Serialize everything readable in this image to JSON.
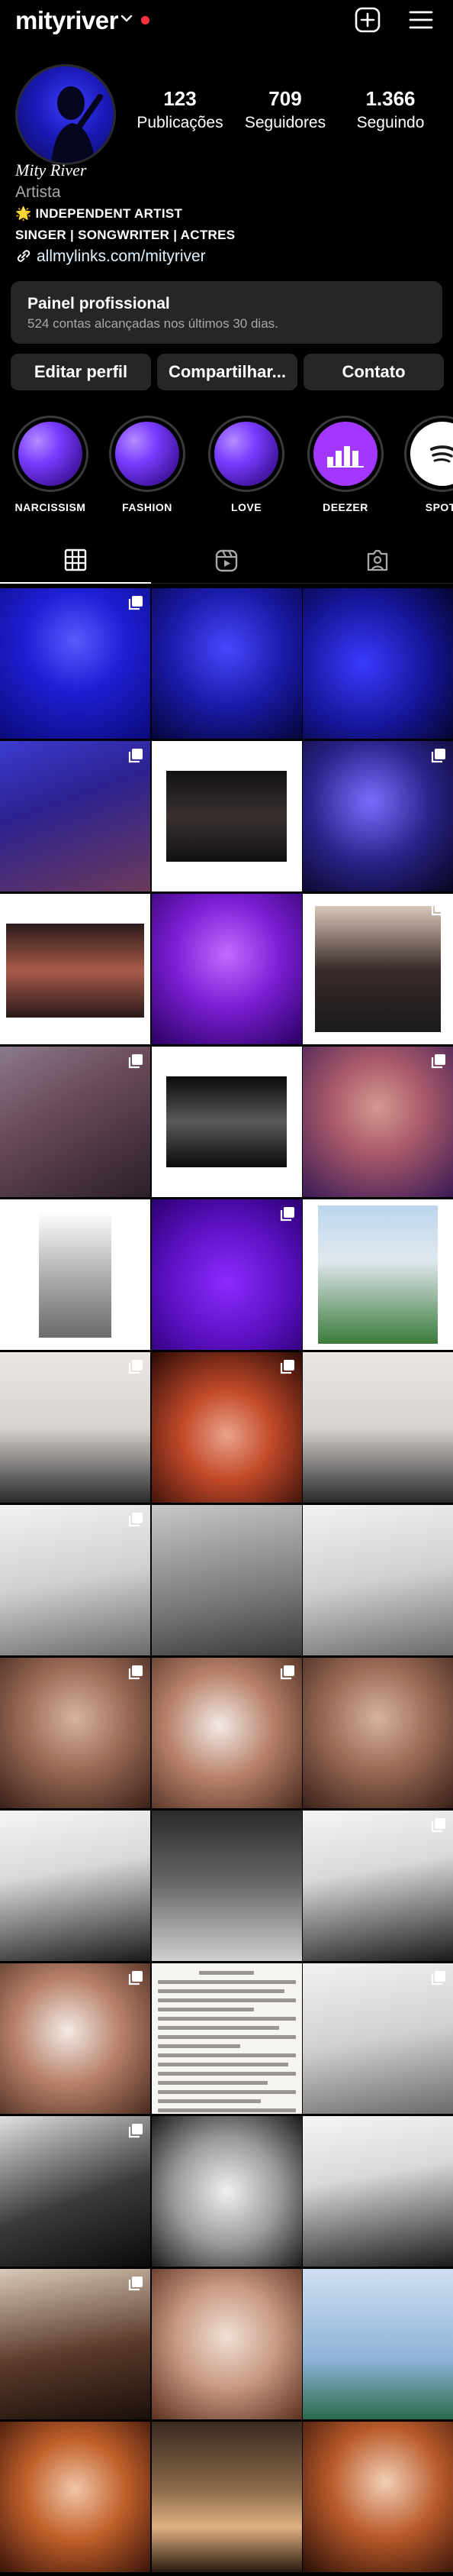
{
  "header": {
    "username": "mityriver",
    "icons": {
      "dropdown": "chevron-down-icon",
      "notification": "red-dot",
      "new_post": "plus-square-icon",
      "menu": "hamburger-menu-icon"
    },
    "notification_color": "#ff3040"
  },
  "profile": {
    "stats": [
      {
        "value": "123",
        "label": "Publicações"
      },
      {
        "value": "709",
        "label": "Seguidores"
      },
      {
        "value": "1.366",
        "label": "Seguindo"
      }
    ],
    "display_name": "Mity River",
    "category": "Artista",
    "bio_line1": "🌟 INDEPENDENT ARTIST",
    "bio_line2": "SINGER | SONGWRITER | ACTRES",
    "link": "allmylinks.com/mityriver"
  },
  "dashboard": {
    "title": "Painel profissional",
    "subtitle": "524 contas alcançadas nos últimos 30 dias."
  },
  "actions": {
    "edit": "Editar perfil",
    "share": "Compartilhar...",
    "contact": "Contato"
  },
  "highlights": [
    {
      "label": "NARCISSISM",
      "icon": "glitter-cover"
    },
    {
      "label": "FASHION",
      "icon": "glitter-cover"
    },
    {
      "label": "LOVE",
      "icon": "glitter-cover"
    },
    {
      "label": "DEEZER",
      "icon": "deezer-logo-icon"
    },
    {
      "label": "SPOTI",
      "icon": "spotify-logo-icon"
    }
  ],
  "tabs": [
    {
      "name": "grid",
      "icon": "grid-icon",
      "active": true
    },
    {
      "name": "reels",
      "icon": "reels-icon",
      "active": false
    },
    {
      "name": "tagged",
      "icon": "tagged-icon",
      "active": false
    }
  ],
  "colors": {
    "background": "#000000",
    "surface": "#262626",
    "muted_text": "#a8a8a8",
    "link_text": "#e0f1ff",
    "deezer": "#a238ff"
  }
}
